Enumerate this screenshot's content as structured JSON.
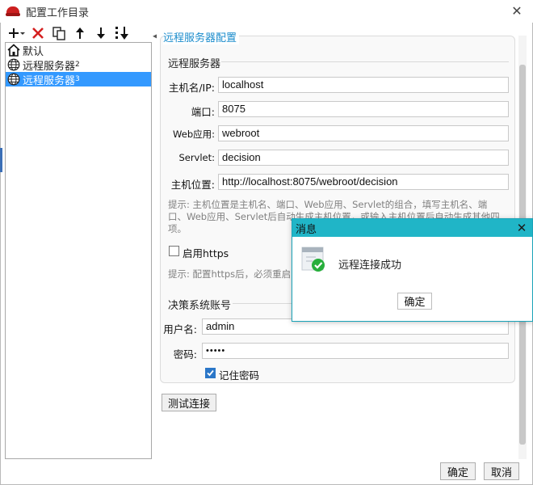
{
  "window": {
    "title": "配置工作目录",
    "close_icon": "close-icon"
  },
  "toolbar": {
    "buttons": [
      {
        "icon": "add-dropdown-icon",
        "symbol": "+"
      },
      {
        "icon": "delete-icon",
        "symbol": "✕"
      },
      {
        "icon": "copy-icon",
        "symbol": "⧉"
      },
      {
        "icon": "move-up-icon",
        "symbol": "↑"
      },
      {
        "icon": "move-down-icon",
        "symbol": "↓"
      },
      {
        "icon": "sort-icon",
        "symbol": "⇣"
      }
    ]
  },
  "tree": {
    "items": [
      {
        "label": "默认",
        "icon": "home-icon",
        "selected": false
      },
      {
        "label": "远程服务器",
        "sub": "2",
        "icon": "globe-icon",
        "selected": false
      },
      {
        "label": "远程服务器",
        "sub": "3",
        "icon": "globe-icon",
        "selected": true
      }
    ]
  },
  "panel": {
    "title": "远程服务器配置",
    "server_group": "远程服务器",
    "fields": {
      "host_label": "主机名/IP:",
      "host_value": "localhost",
      "port_label": "端口:",
      "port_value": "8075",
      "webapp_label": "Web应用:",
      "webapp_value": "webroot",
      "servlet_label": "Servlet:",
      "servlet_value": "decision",
      "location_label": "主机位置:",
      "location_value": "http://localhost:8075/webroot/decision"
    },
    "hint1_line1": "提示: 主机位置是主机名、端口、Web应用、Servlet的组合，填写主机名、端",
    "hint1_line2": "口、Web应用、Servlet后自动生成主机位置，或输入主机位置后自动生成其他四",
    "hint1_line3": "项。",
    "https_label": "启用https",
    "https_checked": false,
    "hint2": "提示: 配置https后，必须重启",
    "account_group": "决策系统账号",
    "username_label": "用户名:",
    "username_value": "admin",
    "password_label": "密码:",
    "password_value": "•••••",
    "remember_label": "记住密码",
    "remember_checked": true,
    "test_button": "测试连接"
  },
  "footer": {
    "ok": "确定",
    "cancel": "取消"
  },
  "popup": {
    "title": "消息",
    "message": "远程连接成功",
    "ok": "确定",
    "icon": "success-check-icon"
  },
  "colors": {
    "accent": "#1b8ccc",
    "selection": "#3399ff",
    "popup_header": "#20b5c7",
    "success": "#27ae3c",
    "delete": "#d42020"
  }
}
